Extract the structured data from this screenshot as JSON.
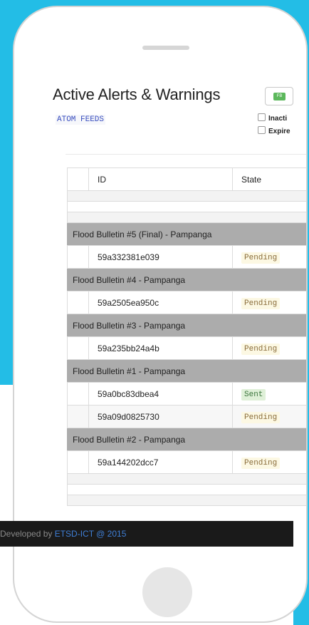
{
  "header": {
    "title": "Active Alerts & Warnings",
    "fb_button_label": "FB",
    "atom_feeds": "ATOM FEEDS",
    "filters": [
      "Inacti",
      "Expire"
    ]
  },
  "table": {
    "columns": [
      "ID",
      "State"
    ],
    "groups": [
      {
        "name": "Flood Bulletin #5 (Final) - Pampanga",
        "rows": [
          {
            "id": "59a332381e039",
            "state": "Pending"
          }
        ]
      },
      {
        "name": "Flood Bulletin #4 - Pampanga",
        "rows": [
          {
            "id": "59a2505ea950c",
            "state": "Pending"
          }
        ]
      },
      {
        "name": "Flood Bulletin #3 - Pampanga",
        "rows": [
          {
            "id": "59a235bb24a4b",
            "state": "Pending"
          }
        ]
      },
      {
        "name": "Flood Bulletin #1 - Pampanga",
        "rows": [
          {
            "id": "59a0bc83dbea4",
            "state": "Sent"
          },
          {
            "id": "59a09d0825730",
            "state": "Pending"
          }
        ]
      },
      {
        "name": "Flood Bulletin #2 - Pampanga",
        "rows": [
          {
            "id": "59a144202dcc7",
            "state": "Pending"
          }
        ]
      }
    ]
  },
  "footer": {
    "text": "Developed by ",
    "link": "ETSD-ICT @ 2015"
  },
  "colors": {
    "background": "#23bde6",
    "group_row": "#acacac",
    "pending_badge": "#fcf8e3",
    "sent_badge": "#dff0d8",
    "footer": "#1a1a1a",
    "link": "#3f7fd6"
  }
}
